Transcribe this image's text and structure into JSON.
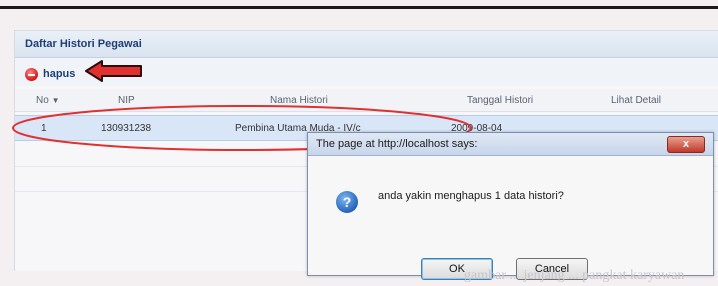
{
  "panel": {
    "title": "Daftar Histori Pegawai",
    "toolbar": {
      "delete_label": "hapus"
    }
  },
  "grid": {
    "columns": [
      "No",
      "NIP",
      "Nama Histori",
      "Tanggal Histori",
      "Lihat Detail"
    ],
    "rows": [
      {
        "no": "1",
        "nip": "130931238",
        "nama": "Pembina Utama Muda - IV/c",
        "tanggal": "2009-08-04"
      }
    ]
  },
  "dialog": {
    "title": "The page at http://localhost says:",
    "message": "anda yakin menghapus 1 data histori?",
    "ok_label": "OK",
    "cancel_label": "Cancel",
    "close_symbol": "x",
    "icon_symbol": "?"
  },
  "background_text": "... gambar ... jenjang ... pangkat karyawan",
  "annotations": {
    "color": "#e03030"
  },
  "icons": {
    "delete": "minus-circle-icon",
    "sort": "sort-desc-icon",
    "question": "question-icon",
    "close": "close-icon"
  }
}
